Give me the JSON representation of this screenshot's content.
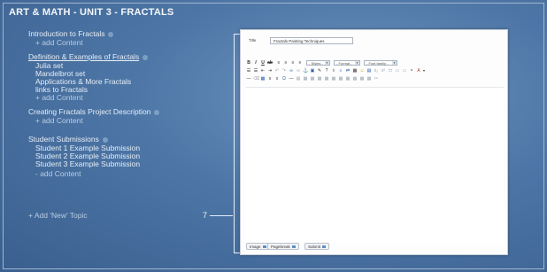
{
  "page_title": "ART & MATH - UNIT 3 - FRACTALS",
  "nav": {
    "topics": [
      {
        "label": "Introduction to Fractals",
        "add": "+ add Content"
      },
      {
        "label": "Definition & Examples of Fractals",
        "children": [
          "Julia set",
          "Mandelbrot set",
          "Applications & More Fractals",
          "links to Fractals"
        ],
        "add": "+ add Content"
      },
      {
        "label": "Creating Fractals Project Description",
        "add": "+ add Content"
      },
      {
        "label": "Student Submissions",
        "children": [
          "Student 1 Example Submission",
          "Student 2 Example Submission",
          "Student 3 Example Submission"
        ],
        "add": "- add Content"
      }
    ],
    "add_topic": "+ Add 'New' Topic"
  },
  "callout_number": "7",
  "editor": {
    "title_label": "Title",
    "title_value": "Fractals Painting Techniques",
    "style_select": "- Styles -",
    "format_select": "- Format -",
    "font_select": "- Font family -",
    "buttons": {
      "image": "Image",
      "pagebreak": "Pagebreak",
      "submit": "Submit"
    }
  }
}
